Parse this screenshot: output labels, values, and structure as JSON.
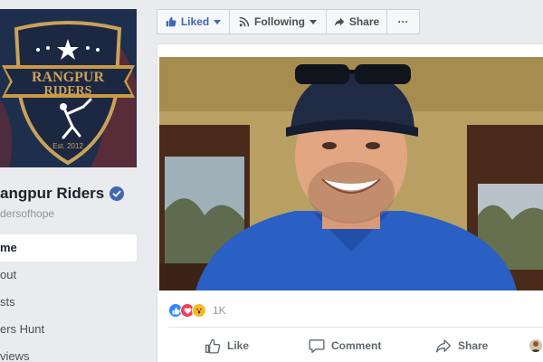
{
  "page": {
    "name": "angpur Riders",
    "handle": "dersofhope",
    "cover": {
      "logo_line1": "RANGPUR",
      "logo_line2": "RIDERS",
      "logo_est": "Est. 2012"
    }
  },
  "nav": {
    "items": [
      {
        "label": "me",
        "active": true
      },
      {
        "label": "out"
      },
      {
        "label": "sts"
      },
      {
        "label": "ers Hunt"
      },
      {
        "label": "views"
      }
    ]
  },
  "actions": {
    "liked": "Liked",
    "following": "Following",
    "share": "Share",
    "more": "···"
  },
  "post": {
    "reaction_count": "1K",
    "like": "Like",
    "comment": "Comment",
    "share": "Share"
  },
  "colors": {
    "brand_blue": "#4267b2",
    "reaction_like": "#2d88ff",
    "reaction_love": "#f33e58",
    "reaction_wow": "#f7b928"
  }
}
